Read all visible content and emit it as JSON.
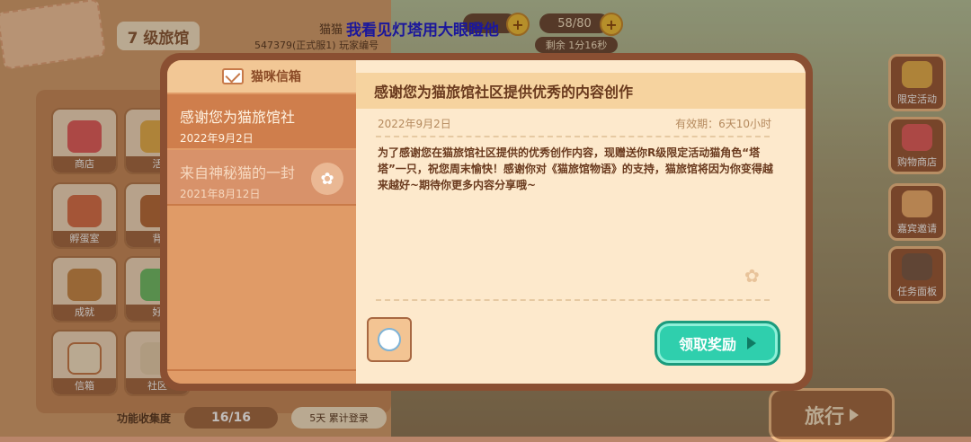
{
  "hud": {
    "level": "7 级旅馆",
    "player_name": "猫猫",
    "player_id": "547379(正式服1) 玩家编号",
    "overlay_text": "我看见灯塔用大眼瞪他",
    "energy": "58/80",
    "timer": "剩余 1分16秒"
  },
  "side_buttons": [
    "限定活动",
    "购物商店",
    "嘉宾邀请",
    "任务面板"
  ],
  "grid_buttons": [
    "商店",
    "活",
    "孵蛋室",
    "背",
    "成就",
    "好",
    "信箱",
    "社区"
  ],
  "bottom": {
    "collect_label": "功能收集度",
    "collect_value": "16/16",
    "login_label": "5天 累计登录",
    "travel_label": "旅行"
  },
  "mailbox": {
    "title": "猫咪信箱",
    "items": [
      {
        "title": "感谢您为猫旅馆社",
        "date": "2022年9月2日"
      },
      {
        "title": "来自神秘猫的一封",
        "date": "2021年8月12日"
      }
    ]
  },
  "message": {
    "title": "感谢您为猫旅馆社区提供优秀的内容创作",
    "date": "2022年9月2日",
    "expiry": "有效期：6天10小时",
    "body": "为了感谢您在猫旅馆社区提供的优秀创作内容，现赠送你R级限定活动猫角色“塔塔”一只，祝您周末愉快！感谢你对《猫旅馆物语》的支持，猫旅馆将因为你变得越来越好~期待你更多内容分享哦~",
    "claim_label": "领取奖励"
  },
  "colors": {
    "accent": "#2fcfad",
    "modal_border": "#8a4f32",
    "panel": "#fde9cc"
  }
}
